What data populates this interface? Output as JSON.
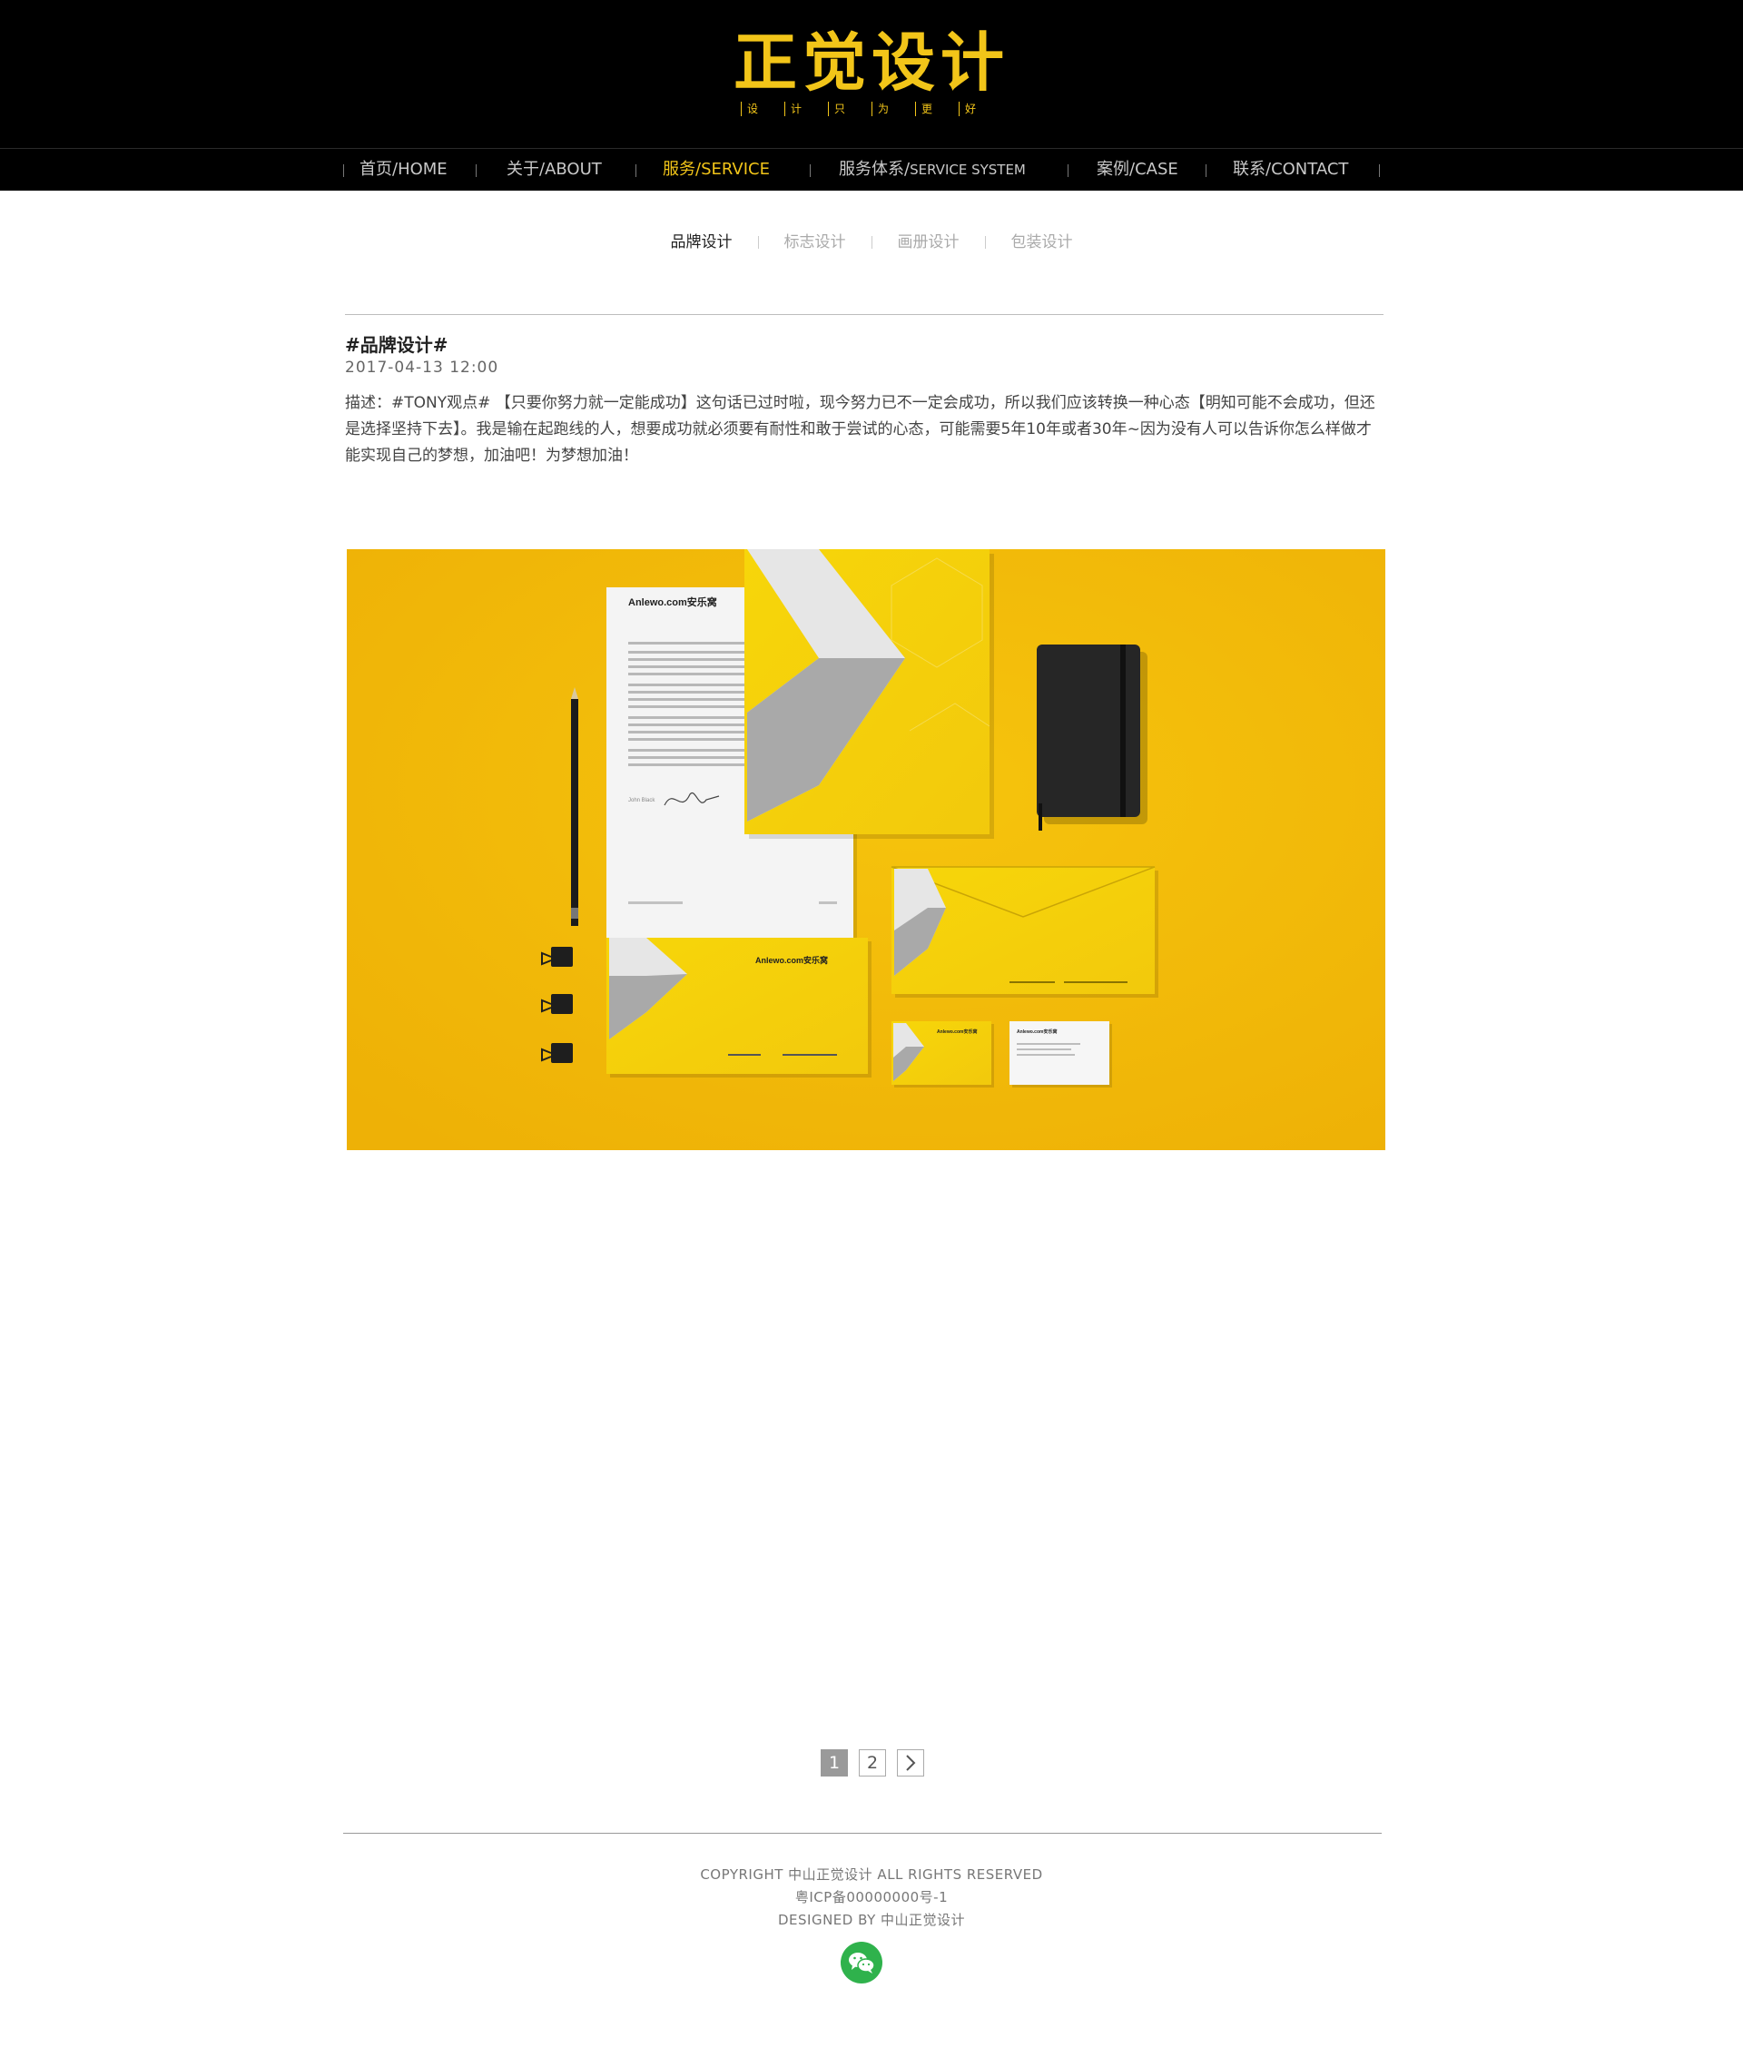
{
  "brand": {
    "title": "正觉设计",
    "tagline": [
      "设",
      "计",
      "只",
      "为",
      "更",
      "好"
    ],
    "accent_color": "#f2c519"
  },
  "nav": {
    "items": [
      {
        "label": "首页/HOME"
      },
      {
        "label": "关于/ABOUT"
      },
      {
        "label": "服务/SERVICE",
        "active": true
      },
      {
        "label_cn": "服务体系/",
        "label_en": "SERVICE SYSTEM"
      },
      {
        "label": "案例/CASE"
      },
      {
        "label": "联系/CONTACT"
      }
    ]
  },
  "subnav": {
    "items": [
      "品牌设计",
      "标志设计",
      "画册设计",
      "包装设计"
    ],
    "active_index": 0
  },
  "article": {
    "title": "#品牌设计#",
    "date": "2017-04-13  12:00",
    "description": "描述：#TONY观点# 【只要你努力就一定能成功】这句话已过时啦，现今努力已不一定会成功，所以我们应该转换一种心态【明知可能不会成功，但还是选择坚持下去】。我是输在起跑线的人，想要成功就必须要有耐性和敢于尝试的心态，可能需要5年10年或者30年~因为没有人可以告诉你怎么样做才能实现自己的梦想，加油吧！为梦想加油！"
  },
  "hero": {
    "brand_text": "Anlewo.com安乐窝",
    "signature_name": "John Black",
    "background_color": "#f0b90a"
  },
  "pagination": {
    "pages": [
      "1",
      "2"
    ],
    "current": "1",
    "next_icon": "chevron-right-icon"
  },
  "footer": {
    "copyright": "COPYRIGHT 中山正觉设计 ALL RIGHTS RESERVED",
    "icp": "粤ICP备00000000号-1",
    "designed_by": "DESIGNED BY 中山正觉设计",
    "social_icon": "wechat-icon",
    "social_color": "#2fb24c"
  }
}
